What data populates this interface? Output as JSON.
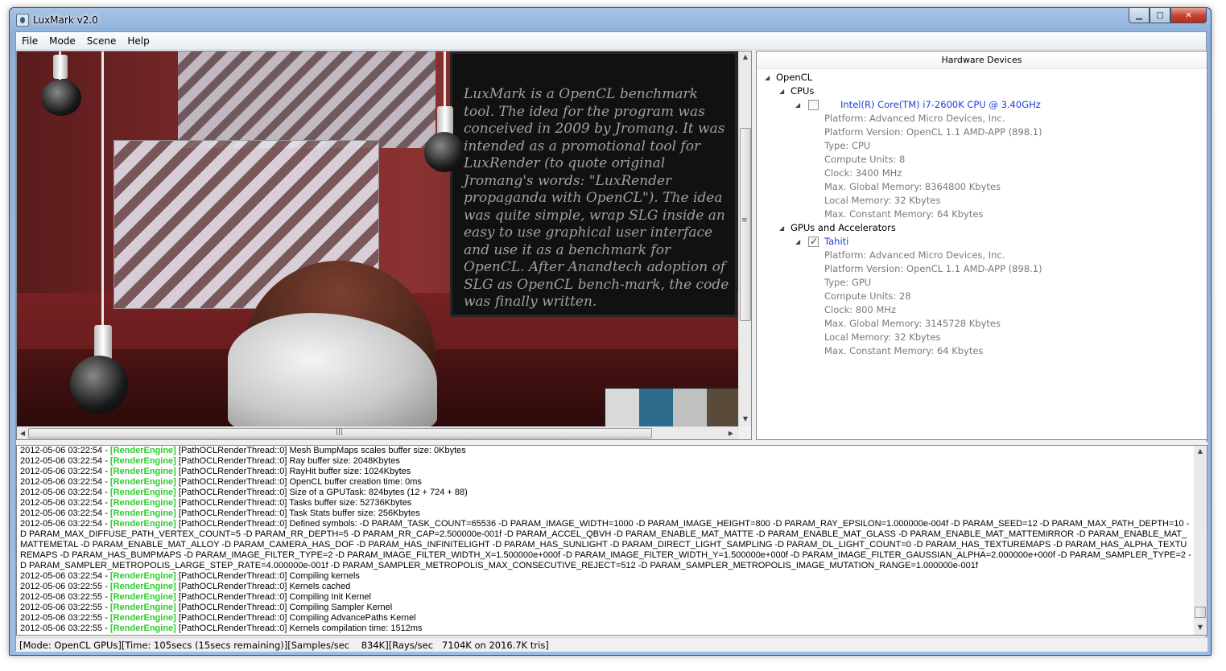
{
  "window": {
    "title": "LuxMark v2.0"
  },
  "menu": [
    "File",
    "Mode",
    "Scene",
    "Help"
  ],
  "render": {
    "blackboard_text": "LuxMark is a OpenCL benchmark tool. The idea for the program was conceived in 2009 by Jromang. It was intended as a promotional tool for LuxRender (to quote original Jromang's words: \"LuxRender propaganda with OpenCL\"). The idea was quite simple, wrap SLG inside an easy to use graphical user interface and use it as a benchmark for OpenCL. After Anandtech adoption of SLG as OpenCL bench-mark, the code was finally written."
  },
  "hardware": {
    "header": "Hardware Devices",
    "root": "OpenCL",
    "groups": [
      {
        "label": "CPUs",
        "devices": [
          {
            "name": "Intel(R) Core(TM) i7-2600K CPU @ 3.40GHz",
            "checked": false,
            "props": [
              "Platform: Advanced Micro Devices, Inc.",
              "Platform Version: OpenCL 1.1 AMD-APP (898.1)",
              "Type: CPU",
              "Compute Units: 8",
              "Clock: 3400 MHz",
              "Max. Global Memory: 8364800 Kbytes",
              "Local Memory: 32 Kbytes",
              "Max. Constant Memory: 64 Kbytes"
            ]
          }
        ]
      },
      {
        "label": "GPUs and Accelerators",
        "devices": [
          {
            "name": "Tahiti",
            "checked": true,
            "props": [
              "Platform: Advanced Micro Devices, Inc.",
              "Platform Version: OpenCL 1.1 AMD-APP (898.1)",
              "Type: GPU",
              "Compute Units: 28",
              "Clock: 800 MHz",
              "Max. Global Memory: 3145728 Kbytes",
              "Local Memory: 32 Kbytes",
              "Max. Constant Memory: 64 Kbytes"
            ]
          }
        ]
      }
    ]
  },
  "log": {
    "tag": "[RenderEngine]",
    "lines": [
      {
        "ts": "2012-05-06 03:22:54 - ",
        "msg": " [PathOCLRenderThread::0] Mesh BumpMaps scales buffer size: 0Kbytes"
      },
      {
        "ts": "2012-05-06 03:22:54 - ",
        "msg": " [PathOCLRenderThread::0] Ray buffer size: 2048Kbytes"
      },
      {
        "ts": "2012-05-06 03:22:54 - ",
        "msg": " [PathOCLRenderThread::0] RayHit buffer size: 1024Kbytes"
      },
      {
        "ts": "2012-05-06 03:22:54 - ",
        "msg": " [PathOCLRenderThread::0] OpenCL buffer creation time: 0ms"
      },
      {
        "ts": "2012-05-06 03:22:54 - ",
        "msg": " [PathOCLRenderThread::0] Size of a GPUTask: 824bytes (12 + 724 + 88)"
      },
      {
        "ts": "2012-05-06 03:22:54 - ",
        "msg": " [PathOCLRenderThread::0] Tasks buffer size: 52736Kbytes"
      },
      {
        "ts": "2012-05-06 03:22:54 - ",
        "msg": " [PathOCLRenderThread::0] Task Stats buffer size: 256Kbytes"
      },
      {
        "ts": "2012-05-06 03:22:54 - ",
        "msg": " [PathOCLRenderThread::0] Defined symbols: -D PARAM_TASK_COUNT=65536 -D PARAM_IMAGE_WIDTH=1000 -D PARAM_IMAGE_HEIGHT=800 -D PARAM_RAY_EPSILON=1.000000e-004f -D PARAM_SEED=12 -D PARAM_MAX_PATH_DEPTH=10 -D PARAM_MAX_DIFFUSE_PATH_VERTEX_COUNT=5 -D PARAM_RR_DEPTH=5 -D PARAM_RR_CAP=2.500000e-001f -D PARAM_ACCEL_QBVH -D PARAM_ENABLE_MAT_MATTE -D PARAM_ENABLE_MAT_GLASS -D PARAM_ENABLE_MAT_MATTEMIRROR -D PARAM_ENABLE_MAT_MATTEMETAL -D PARAM_ENABLE_MAT_ALLOY -D PARAM_CAMERA_HAS_DOF -D PARAM_HAS_INFINITELIGHT -D PARAM_HAS_SUNLIGHT -D PARAM_DIRECT_LIGHT_SAMPLING -D PARAM_DL_LIGHT_COUNT=0 -D PARAM_HAS_TEXTUREMAPS -D PARAM_HAS_ALPHA_TEXTUREMAPS -D PARAM_HAS_BUMPMAPS -D PARAM_IMAGE_FILTER_TYPE=2 -D PARAM_IMAGE_FILTER_WIDTH_X=1.500000e+000f -D PARAM_IMAGE_FILTER_WIDTH_Y=1.500000e+000f -D PARAM_IMAGE_FILTER_GAUSSIAN_ALPHA=2.000000e+000f -D PARAM_SAMPLER_TYPE=2 -D PARAM_SAMPLER_METROPOLIS_LARGE_STEP_RATE=4.000000e-001f -D PARAM_SAMPLER_METROPOLIS_MAX_CONSECUTIVE_REJECT=512 -D PARAM_SAMPLER_METROPOLIS_IMAGE_MUTATION_RANGE=1.000000e-001f"
      },
      {
        "ts": "2012-05-06 03:22:54 - ",
        "msg": " [PathOCLRenderThread::0] Compiling kernels"
      },
      {
        "ts": "2012-05-06 03:22:55 - ",
        "msg": " [PathOCLRenderThread::0] Kernels cached"
      },
      {
        "ts": "2012-05-06 03:22:55 - ",
        "msg": " [PathOCLRenderThread::0] Compiling Init Kernel"
      },
      {
        "ts": "2012-05-06 03:22:55 - ",
        "msg": " [PathOCLRenderThread::0] Compiling Sampler Kernel"
      },
      {
        "ts": "2012-05-06 03:22:55 - ",
        "msg": " [PathOCLRenderThread::0] Compiling AdvancePaths Kernel"
      },
      {
        "ts": "2012-05-06 03:22:55 - ",
        "msg": " [PathOCLRenderThread::0] Kernels compilation time: 1512ms"
      }
    ]
  },
  "status": {
    "text": "[Mode: OpenCL GPUs][Time: 105secs (15secs remaining)][Samples/sec    834K][Rays/sec   7104K on 2016.7K tris]"
  },
  "colors": {
    "log_tag": "#2ecc2e",
    "device_name": "#1a3fd8",
    "property_text": "#7a7a7a"
  }
}
